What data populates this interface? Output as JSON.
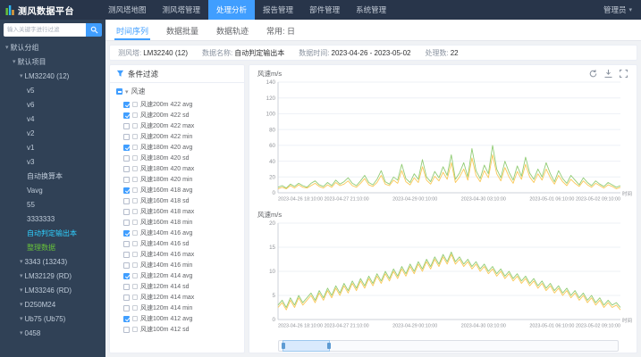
{
  "navbar": {
    "logo_text": "测风数据平台",
    "user_label": "管理员",
    "items": [
      {
        "label": "测风塔地图",
        "active": false
      },
      {
        "label": "测风塔管理",
        "active": false
      },
      {
        "label": "处理分析",
        "active": true
      },
      {
        "label": "报告管理",
        "active": false
      },
      {
        "label": "部件管理",
        "active": false
      },
      {
        "label": "系统管理",
        "active": false
      }
    ]
  },
  "sidebar": {
    "search_placeholder": "输入关键字进行过滤",
    "tree": [
      {
        "label": "默认分组",
        "level": 0,
        "caret": true
      },
      {
        "label": "默认项目",
        "level": 1,
        "caret": true
      },
      {
        "label": "LM32240 (12)",
        "level": 2,
        "caret": true
      },
      {
        "label": "v5",
        "level": 3
      },
      {
        "label": "v6",
        "level": 3
      },
      {
        "label": "v4",
        "level": 3
      },
      {
        "label": "v2",
        "level": 3
      },
      {
        "label": "v1",
        "level": 3
      },
      {
        "label": "v3",
        "level": 3
      },
      {
        "label": "自动换算本",
        "level": 3
      },
      {
        "label": "Vavg",
        "level": 3
      },
      {
        "label": "55",
        "level": 3
      },
      {
        "label": "3333333",
        "level": 3
      },
      {
        "label": "自动判定输出本",
        "level": 3,
        "selected": true
      },
      {
        "label": "整理数据",
        "level": 3,
        "green": true
      },
      {
        "label": "3343 (13243)",
        "level": 2,
        "caret": true
      },
      {
        "label": "LM32129 (RD)",
        "level": 2,
        "caret": true
      },
      {
        "label": "LM33246 (RD)",
        "level": 2,
        "caret": true
      },
      {
        "label": "D250M24",
        "level": 2,
        "caret": true
      },
      {
        "label": "Ub75 (Ub75)",
        "level": 2,
        "caret": true
      },
      {
        "label": "0458",
        "level": 2,
        "caret": true
      }
    ]
  },
  "tabs": [
    {
      "label": "时间序列",
      "active": true
    },
    {
      "label": "数据批量",
      "active": false
    },
    {
      "label": "数据轨迹",
      "active": false
    },
    {
      "label": "常用: 日",
      "active": false
    }
  ],
  "info": {
    "items": [
      {
        "label": "测风塔:",
        "value": "LM32240 (12)"
      },
      {
        "label": "数据名称:",
        "value": "自动判定输出本"
      },
      {
        "label": "数据时间:",
        "value": "2023-04-26 - 2023-05-02"
      },
      {
        "label": "处理数:",
        "value": "22"
      }
    ]
  },
  "filter": {
    "title": "条件过滤",
    "group_label": "风速",
    "items": [
      {
        "label": "风速200m 422 avg",
        "checked": true
      },
      {
        "label": "风速200m 422 sd",
        "checked": true
      },
      {
        "label": "风速200m 422 max",
        "checked": false
      },
      {
        "label": "风速200m 422 min",
        "checked": false
      },
      {
        "label": "风速180m 420 avg",
        "checked": true
      },
      {
        "label": "风速180m 420 sd",
        "checked": false
      },
      {
        "label": "风速180m 420 max",
        "checked": false
      },
      {
        "label": "风速180m 420 min",
        "checked": false
      },
      {
        "label": "风速160m 418 avg",
        "checked": true
      },
      {
        "label": "风速160m 418 sd",
        "checked": false
      },
      {
        "label": "风速160m 418 max",
        "checked": false
      },
      {
        "label": "风速160m 418 min",
        "checked": false
      },
      {
        "label": "风速140m 416 avg",
        "checked": true
      },
      {
        "label": "风速140m 416 sd",
        "checked": false
      },
      {
        "label": "风速140m 416 max",
        "checked": false
      },
      {
        "label": "风速140m 416 min",
        "checked": false
      },
      {
        "label": "风速120m 414 avg",
        "checked": true
      },
      {
        "label": "风速120m 414 sd",
        "checked": false
      },
      {
        "label": "风速120m 414 max",
        "checked": false
      },
      {
        "label": "风速120m 414 min",
        "checked": false
      },
      {
        "label": "风速100m 412 avg",
        "checked": true
      },
      {
        "label": "风速100m 412 sd",
        "checked": false
      }
    ]
  },
  "chart_data": [
    {
      "type": "line",
      "title": "风速m/s",
      "xlabel": "时间",
      "ylim": [
        0,
        140
      ],
      "ytick_step": 20,
      "grid": true,
      "x_ticks": [
        "2023-04-26 18:10:00",
        "2023-04-27 21:10:00",
        "2023-04-29 00:10:00",
        "2023-04-30 03:10:00",
        "2023-05-01 06:10:00",
        "2023-05-02 09:10:00"
      ],
      "series": [
        {
          "name": "风速200m 422 avg",
          "color": "#91cc75",
          "values": [
            7,
            9,
            6,
            11,
            8,
            12,
            9,
            7,
            12,
            15,
            10,
            8,
            13,
            9,
            16,
            11,
            14,
            19,
            12,
            9,
            15,
            22,
            13,
            10,
            17,
            28,
            14,
            11,
            20,
            16,
            36,
            18,
            13,
            24,
            17,
            42,
            20,
            14,
            27,
            19,
            33,
            22,
            48,
            17,
            25,
            38,
            20,
            56,
            28,
            18,
            35,
            24,
            60,
            30,
            19,
            40,
            26,
            16,
            34,
            21,
            45,
            25,
            17,
            30,
            20,
            38,
            24,
            14,
            28,
            18,
            12,
            22,
            16,
            10,
            19,
            13,
            9,
            15,
            11,
            8,
            13,
            10,
            7,
            9
          ]
        },
        {
          "name": "风速180m 420 avg",
          "color": "#fac858",
          "values": [
            5,
            7,
            5,
            9,
            6,
            10,
            7,
            6,
            9,
            12,
            8,
            6,
            10,
            7,
            13,
            9,
            11,
            15,
            9,
            7,
            12,
            18,
            10,
            8,
            13,
            22,
            11,
            9,
            16,
            12,
            28,
            14,
            10,
            19,
            13,
            33,
            16,
            11,
            21,
            15,
            26,
            17,
            38,
            13,
            20,
            30,
            16,
            44,
            22,
            14,
            28,
            19,
            48,
            24,
            15,
            32,
            20,
            12,
            27,
            17,
            36,
            20,
            13,
            24,
            16,
            30,
            19,
            11,
            22,
            14,
            9,
            17,
            12,
            8,
            15,
            10,
            7,
            12,
            9,
            6,
            10,
            8,
            5,
            7
          ]
        }
      ]
    },
    {
      "type": "line",
      "title": "风速m/s",
      "xlabel": "时间",
      "ylim": [
        0,
        20
      ],
      "ytick_step": 5,
      "grid": true,
      "x_ticks": [
        "2023-04-26 18:10:00",
        "2023-04-27 21:10:00",
        "2023-04-29 00:10:00",
        "2023-04-30 03:10:00",
        "2023-05-01 06:10:00",
        "2023-05-02 09:10:00"
      ],
      "series": [
        {
          "name": "风速200m 422 sd",
          "color": "#91cc75",
          "values": [
            3,
            4,
            2.5,
            4.5,
            3,
            5,
            3.5,
            4.5,
            5.5,
            4,
            6,
            4.5,
            6.5,
            5,
            7,
            5.5,
            7.5,
            6,
            8,
            6.5,
            8.5,
            7,
            9,
            7.5,
            9.5,
            8,
            10,
            8.5,
            10.5,
            9,
            11,
            9.5,
            11.5,
            10,
            12,
            10.5,
            12.5,
            11,
            13,
            11.5,
            13.5,
            12,
            14,
            12,
            13,
            11.5,
            12.5,
            11,
            12,
            10.5,
            11.5,
            10,
            11,
            9.5,
            10.5,
            9,
            10,
            8.5,
            9.5,
            8,
            9,
            7.5,
            8.5,
            7,
            8,
            6.5,
            7.5,
            6,
            7,
            5.5,
            6.5,
            5,
            6,
            4.5,
            5.5,
            4,
            5,
            3.5,
            4.5,
            3,
            4,
            3,
            3.5,
            2.5
          ]
        },
        {
          "name": "风速180m 420 sd",
          "color": "#fac858",
          "values": [
            2.5,
            3.5,
            2,
            4,
            2.5,
            4.5,
            3,
            4,
            5,
            3.5,
            5.5,
            4,
            6,
            4.5,
            6.5,
            5,
            7,
            5.5,
            7.5,
            6,
            8,
            6.5,
            8.5,
            7,
            9,
            7.5,
            9.5,
            8,
            10,
            8.5,
            10.5,
            9,
            11,
            9.5,
            11.5,
            10,
            12,
            10.5,
            12.5,
            11,
            13,
            11.5,
            13.5,
            11.5,
            12.5,
            11,
            12,
            10.5,
            11.5,
            10,
            11,
            9.5,
            10.5,
            9,
            10,
            8.5,
            9.5,
            8,
            9,
            7.5,
            8.5,
            7,
            8,
            6.5,
            7.5,
            6,
            7,
            5.5,
            6.5,
            5,
            6,
            4.5,
            5.5,
            4,
            5,
            3.5,
            4.5,
            3,
            4,
            2.5,
            3.5,
            2.5,
            3,
            2
          ]
        }
      ]
    }
  ],
  "brush": {
    "window": [
      0.01,
      0.15
    ]
  }
}
